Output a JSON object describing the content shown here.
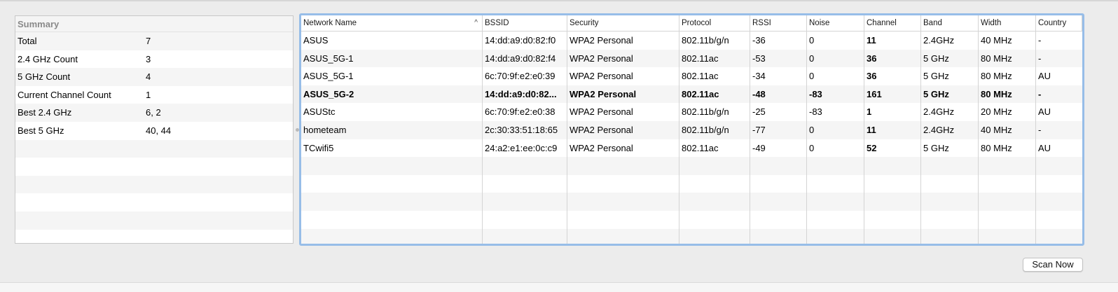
{
  "summary": {
    "title": "Summary",
    "rows": [
      {
        "label": "Total",
        "value": "7"
      },
      {
        "label": "2.4 GHz Count",
        "value": "3"
      },
      {
        "label": "5 GHz Count",
        "value": "4"
      },
      {
        "label": "Current Channel Count",
        "value": "1"
      },
      {
        "label": "Best 2.4 GHz",
        "value": "6, 2"
      },
      {
        "label": "Best 5 GHz",
        "value": "40, 44"
      }
    ]
  },
  "table": {
    "columns": [
      "Network Name",
      "BSSID",
      "Security",
      "Protocol",
      "RSSI",
      "Noise",
      "Channel",
      "Band",
      "Width",
      "Country"
    ],
    "sort_icon": "^",
    "rows": [
      {
        "name": "ASUS",
        "bssid": "14:dd:a9:d0:82:f0",
        "security": "WPA2 Personal",
        "protocol": "802.11b/g/n",
        "rssi": "-36",
        "noise": "0",
        "channel": "11",
        "band": "2.4GHz",
        "width": "40 MHz",
        "country": "-",
        "bold": false
      },
      {
        "name": "ASUS_5G-1",
        "bssid": "14:dd:a9:d0:82:f4",
        "security": "WPA2 Personal",
        "protocol": "802.11ac",
        "rssi": "-53",
        "noise": "0",
        "channel": "36",
        "band": "5 GHz",
        "width": "80 MHz",
        "country": "-",
        "bold": false
      },
      {
        "name": "ASUS_5G-1",
        "bssid": "6c:70:9f:e2:e0:39",
        "security": "WPA2 Personal",
        "protocol": "802.11ac",
        "rssi": "-34",
        "noise": "0",
        "channel": "36",
        "band": "5 GHz",
        "width": "80 MHz",
        "country": "AU",
        "bold": false
      },
      {
        "name": "ASUS_5G-2",
        "bssid": "14:dd:a9:d0:82...",
        "security": "WPA2 Personal",
        "protocol": "802.11ac",
        "rssi": "-48",
        "noise": "-83",
        "channel": "161",
        "band": "5 GHz",
        "width": "80 MHz",
        "country": "-",
        "bold": true
      },
      {
        "name": "ASUStc",
        "bssid": "6c:70:9f:e2:e0:38",
        "security": "WPA2 Personal",
        "protocol": "802.11b/g/n",
        "rssi": "-25",
        "noise": "-83",
        "channel": "1",
        "band": "2.4GHz",
        "width": "20 MHz",
        "country": "AU",
        "bold": false
      },
      {
        "name": "hometeam",
        "bssid": "2c:30:33:51:18:65",
        "security": "WPA2 Personal",
        "protocol": "802.11b/g/n",
        "rssi": "-77",
        "noise": "0",
        "channel": "11",
        "band": "2.4GHz",
        "width": "40 MHz",
        "country": "-",
        "bold": false
      },
      {
        "name": "TCwifi5",
        "bssid": "24:a2:e1:ee:0c:c9",
        "security": "WPA2 Personal",
        "protocol": "802.11ac",
        "rssi": "-49",
        "noise": "0",
        "channel": "52",
        "band": "5 GHz",
        "width": "80 MHz",
        "country": "AU",
        "bold": false
      }
    ]
  },
  "scan_button": "Scan Now",
  "colors": {
    "focus_ring": "#97bde8",
    "row_alt": "#f5f5f5",
    "window_bg": "#ececec"
  }
}
